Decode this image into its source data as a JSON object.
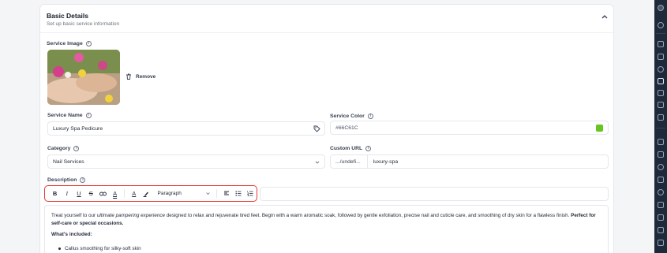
{
  "section": {
    "title": "Basic Details",
    "subtitle": "Set up basic service information"
  },
  "image_field": {
    "label": "Service Image",
    "remove_label": "Remove"
  },
  "name_field": {
    "label": "Service Name",
    "value": "Luxury Spa Pedicure"
  },
  "color_field": {
    "label": "Service Color",
    "value": "#66C61C",
    "swatch": "#66C61C"
  },
  "category_field": {
    "label": "Category",
    "value": "Nail Services"
  },
  "url_field": {
    "label": "Custom URL",
    "prefix": ".../undefi...",
    "value": "luxury-spa"
  },
  "description": {
    "label": "Description",
    "toolbar": {
      "bold": "B",
      "italic": "I",
      "underline": "U",
      "strike": "S",
      "link_icon": "link-icon",
      "clear_format": "A",
      "text_color": "A",
      "highlight_icon": "highlighter-icon",
      "block_type": "Paragraph",
      "align_icon": "align-left-icon",
      "bullets_icon": "bullet-list-icon",
      "numbered_icon": "numbered-list-icon"
    },
    "body": {
      "t1": "Treat yourself to our ",
      "t2": "ultimate pampering experience",
      "t3": " designed to relax and rejuvenate tired feet. Begin with a warm aromatic soak, followed by gentle exfoliation, precise nail and cuticle care, and smoothing of dry skin for a flawless finish. ",
      "t4": "Perfect for self-care or special occasions.",
      "heading": "What's included:",
      "item1": "Callus smoothing for silky-soft skin"
    }
  },
  "colors": {
    "highlight_border": "#E53935",
    "accent_green": "#66C61C",
    "sidebar": "#1E293B"
  }
}
